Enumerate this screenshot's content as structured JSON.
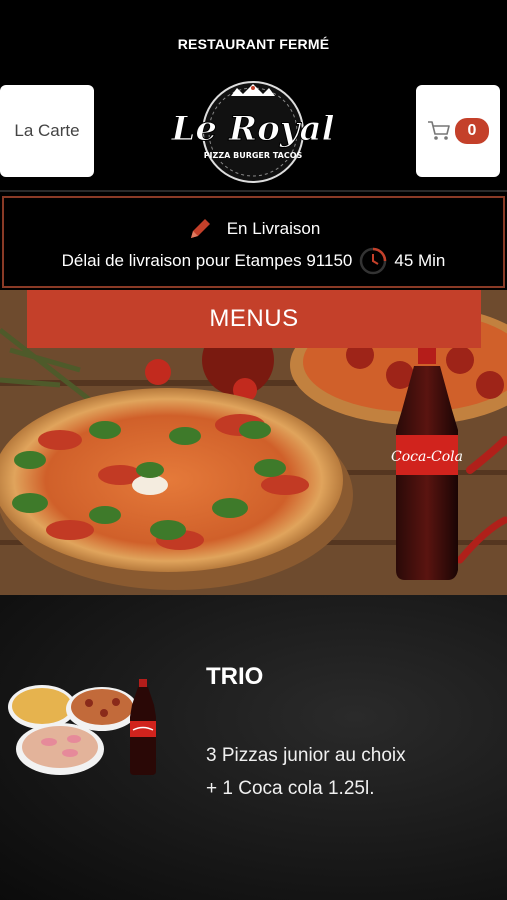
{
  "header": {
    "status": "RESTAURANT FERMÉ",
    "left_button": "La Carte",
    "cart_count": "0",
    "logo_text": "Le Royal",
    "logo_tagline": "PIZZA BURGER TACOS"
  },
  "delivery": {
    "mode": "En Livraison",
    "delay_label": "Délai de livraison pour Etampes 91150",
    "delay_value": "45 Min"
  },
  "menus_button": "MENUS",
  "hero_brand": "Coca-Cola",
  "product": {
    "title": "TRIO",
    "description": "3 Pizzas junior au choix   + 1 Coca cola 1.25l."
  },
  "colors": {
    "accent": "#c4402a",
    "background": "#000000"
  }
}
